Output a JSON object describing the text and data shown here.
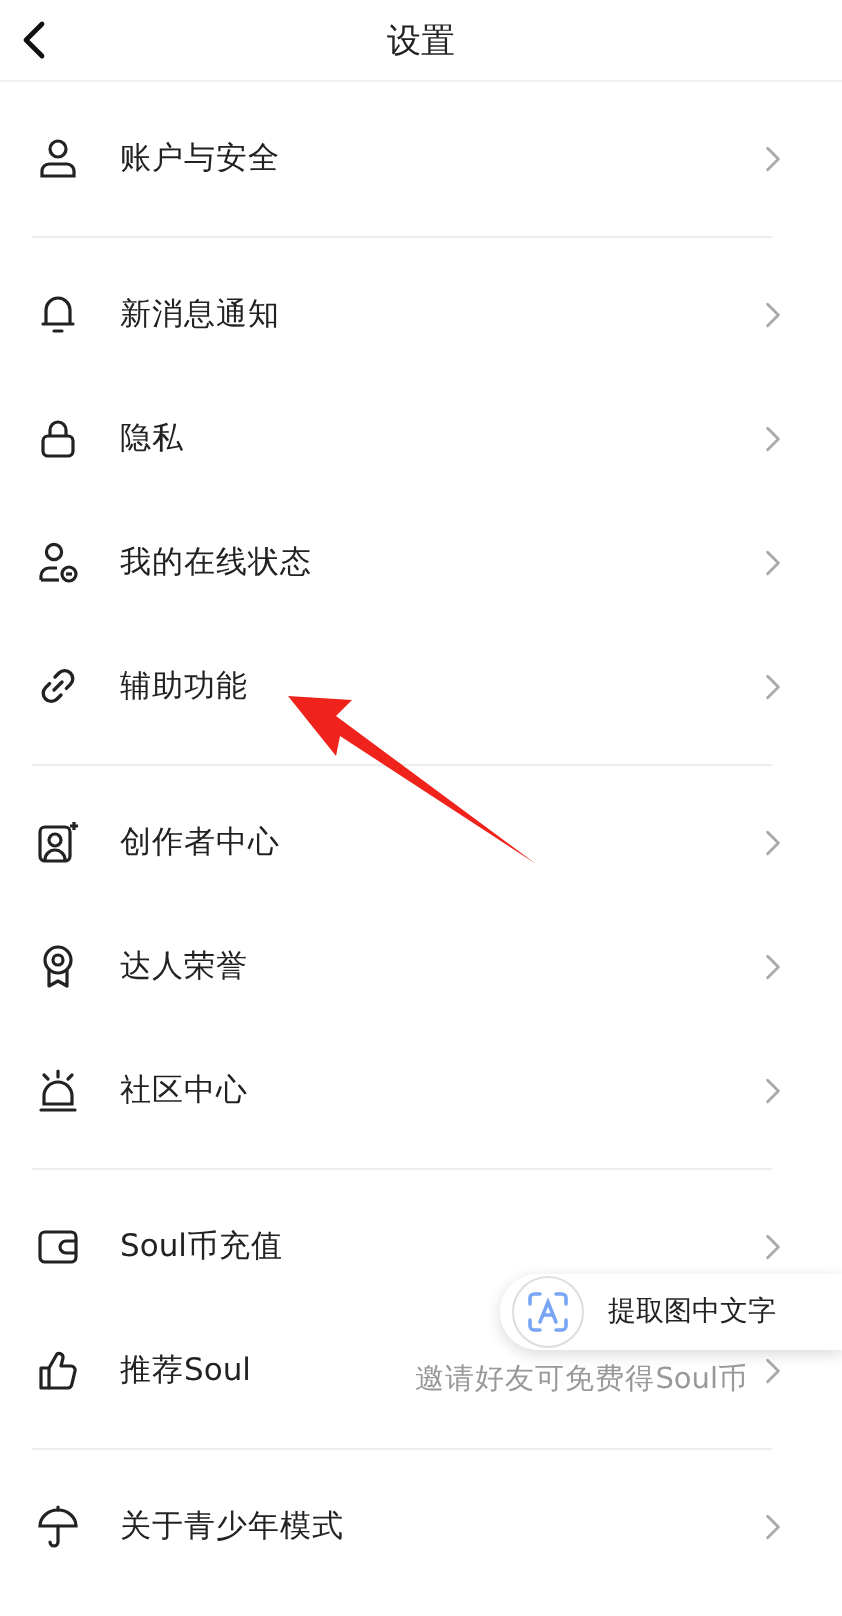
{
  "header": {
    "title": "设置"
  },
  "groups": [
    {
      "items": [
        {
          "label": "账户与安全"
        }
      ]
    },
    {
      "items": [
        {
          "label": "新消息通知"
        },
        {
          "label": "隐私"
        },
        {
          "label": "我的在线状态"
        },
        {
          "label": "辅助功能"
        }
      ]
    },
    {
      "items": [
        {
          "label": "创作者中心"
        },
        {
          "label": "达人荣誉"
        },
        {
          "label": "社区中心"
        }
      ]
    },
    {
      "items": [
        {
          "label": "Soul币充值"
        },
        {
          "label": "推荐Soul",
          "hint": "邀请好友可免费得Soul币"
        }
      ]
    },
    {
      "items": [
        {
          "label": "关于青少年模式"
        }
      ]
    }
  ],
  "text_extract_button": {
    "label": "提取图中文字"
  }
}
